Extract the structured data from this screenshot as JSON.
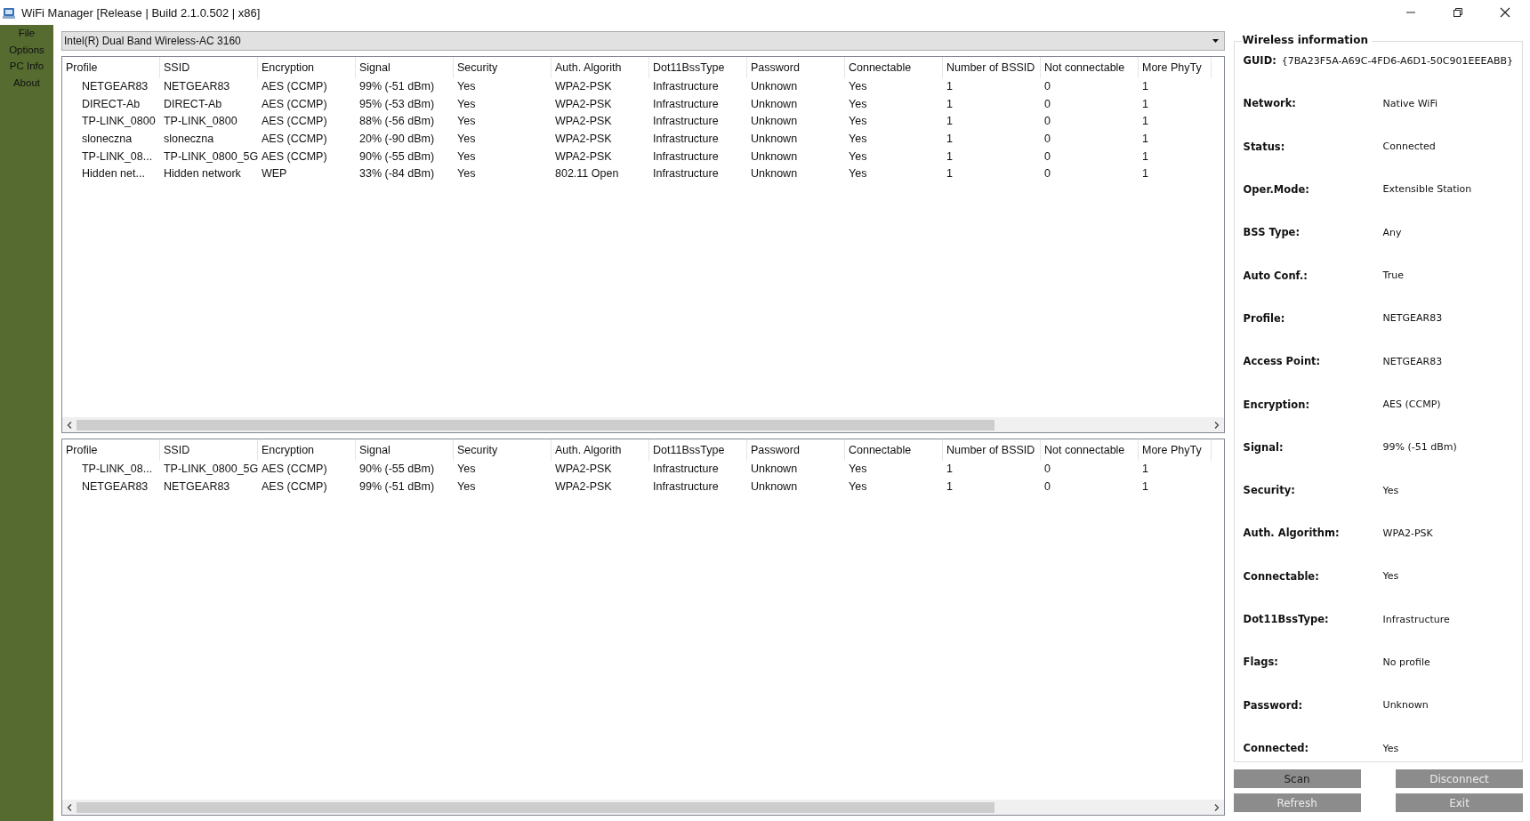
{
  "window": {
    "title": "WiFi Manager [Release | Build 2.1.0.502 | x86]"
  },
  "menu": [
    "File",
    "Options",
    "PC Info",
    "About"
  ],
  "adapter_dropdown": {
    "value": "Intel(R) Dual Band Wireless-AC 3160"
  },
  "tables": [
    {
      "columns": [
        "Profile",
        "SSID",
        "Encryption",
        "Signal",
        "Security",
        "Auth. Algorith",
        "Dot11BssType",
        "Password",
        "Connectable",
        "Number of BSSID",
        "Not connectable",
        "More PhyTy"
      ],
      "rows": [
        [
          "NETGEAR83",
          "NETGEAR83",
          "AES (CCMP)",
          "99% (-51 dBm)",
          "Yes",
          "WPA2-PSK",
          "Infrastructure",
          "Unknown",
          "Yes",
          "1",
          "0",
          "1"
        ],
        [
          "DIRECT-Ab",
          "DIRECT-Ab",
          "AES (CCMP)",
          "95% (-53 dBm)",
          "Yes",
          "WPA2-PSK",
          "Infrastructure",
          "Unknown",
          "Yes",
          "1",
          "0",
          "1"
        ],
        [
          "TP-LINK_0800",
          "TP-LINK_0800",
          "AES (CCMP)",
          "88% (-56 dBm)",
          "Yes",
          "WPA2-PSK",
          "Infrastructure",
          "Unknown",
          "Yes",
          "1",
          "0",
          "1"
        ],
        [
          "sloneczna",
          "sloneczna",
          "AES (CCMP)",
          "20% (-90 dBm)",
          "Yes",
          "WPA2-PSK",
          "Infrastructure",
          "Unknown",
          "Yes",
          "1",
          "0",
          "1"
        ],
        [
          "TP-LINK_08...",
          "TP-LINK_0800_5G",
          "AES (CCMP)",
          "90% (-55 dBm)",
          "Yes",
          "WPA2-PSK",
          "Infrastructure",
          "Unknown",
          "Yes",
          "1",
          "0",
          "1"
        ],
        [
          "Hidden net...",
          "Hidden network",
          "WEP",
          "33% (-84 dBm)",
          "Yes",
          "802.11 Open",
          "Infrastructure",
          "Unknown",
          "Yes",
          "1",
          "0",
          "1"
        ]
      ]
    },
    {
      "columns": [
        "Profile",
        "SSID",
        "Encryption",
        "Signal",
        "Security",
        "Auth. Algorith",
        "Dot11BssType",
        "Password",
        "Connectable",
        "Number of BSSID",
        "Not connectable",
        "More PhyTy"
      ],
      "rows": [
        [
          "TP-LINK_08...",
          "TP-LINK_0800_5G",
          "AES (CCMP)",
          "90% (-55 dBm)",
          "Yes",
          "WPA2-PSK",
          "Infrastructure",
          "Unknown",
          "Yes",
          "1",
          "0",
          "1"
        ],
        [
          "NETGEAR83",
          "NETGEAR83",
          "AES (CCMP)",
          "99% (-51 dBm)",
          "Yes",
          "WPA2-PSK",
          "Infrastructure",
          "Unknown",
          "Yes",
          "1",
          "0",
          "1"
        ]
      ]
    }
  ],
  "wireless_information": {
    "title": "Wireless information",
    "guid": {
      "label": "GUID:",
      "value": "{7BA23F5A-A69C-4FD6-A6D1-50C901EEEABB}"
    },
    "fields": [
      {
        "label": "Network:",
        "value": "Native WiFi"
      },
      {
        "label": "Status:",
        "value": "Connected"
      },
      {
        "label": "Oper.Mode:",
        "value": "Extensible Station"
      },
      {
        "label": "BSS Type:",
        "value": "Any"
      },
      {
        "label": "Auto Conf.:",
        "value": "True"
      },
      {
        "label": "Profile:",
        "value": "NETGEAR83"
      },
      {
        "label": "Access Point:",
        "value": "NETGEAR83"
      },
      {
        "label": "Encryption:",
        "value": "AES (CCMP)"
      },
      {
        "label": "Signal:",
        "value": "99% (-51 dBm)"
      },
      {
        "label": "Security:",
        "value": "Yes"
      },
      {
        "label": "Auth. Algorithm:",
        "value": "WPA2-PSK"
      },
      {
        "label": "Connectable:",
        "value": "Yes"
      },
      {
        "label": "Dot11BssType:",
        "value": "Infrastructure"
      },
      {
        "label": "Flags:",
        "value": "No profile"
      },
      {
        "label": "Password:",
        "value": "Unknown"
      },
      {
        "label": "Connected:",
        "value": "Yes"
      }
    ]
  },
  "buttons": [
    {
      "label": "Scan",
      "disabled": false
    },
    {
      "label": "Disconnect",
      "disabled": true
    },
    {
      "label": "Refresh",
      "disabled": true
    },
    {
      "label": "Exit",
      "disabled": true
    }
  ]
}
